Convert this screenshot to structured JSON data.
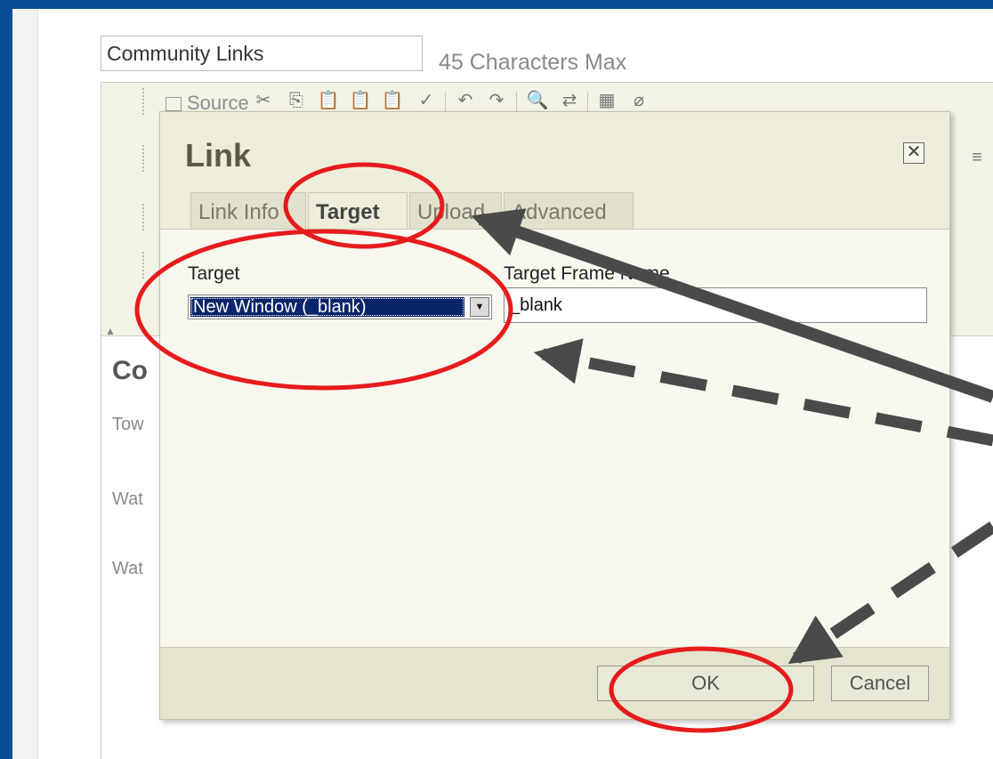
{
  "page": {
    "link_title_value": "Community Links",
    "char_limit_hint": "45 Characters Max"
  },
  "editor": {
    "toolbar": {
      "source_label": "Source",
      "icons": [
        "cut-icon",
        "copy-icon",
        "paste-icon",
        "paste-text-icon",
        "paste-word-icon",
        "spellcheck-icon",
        "undo-icon",
        "redo-icon",
        "find-icon",
        "replace-icon",
        "select-all-icon",
        "remove-format-icon"
      ]
    },
    "content": {
      "heading": "Co",
      "lines": [
        "Tow",
        "Wat",
        "Wat"
      ]
    }
  },
  "dialog": {
    "title": "Link",
    "tabs": [
      {
        "label": "Link Info",
        "active": false
      },
      {
        "label": "Target",
        "active": true
      },
      {
        "label": "Upload",
        "active": false
      },
      {
        "label": "Advanced",
        "active": false
      }
    ],
    "target_label": "Target",
    "target_value": "New Window (_blank)",
    "frame_name_label": "Target Frame Name",
    "frame_name_value": "_blank",
    "ok_label": "OK",
    "cancel_label": "Cancel"
  },
  "annotations": {
    "circle_color": "#e61b1b",
    "arrow_color": "#4a4a4a"
  }
}
